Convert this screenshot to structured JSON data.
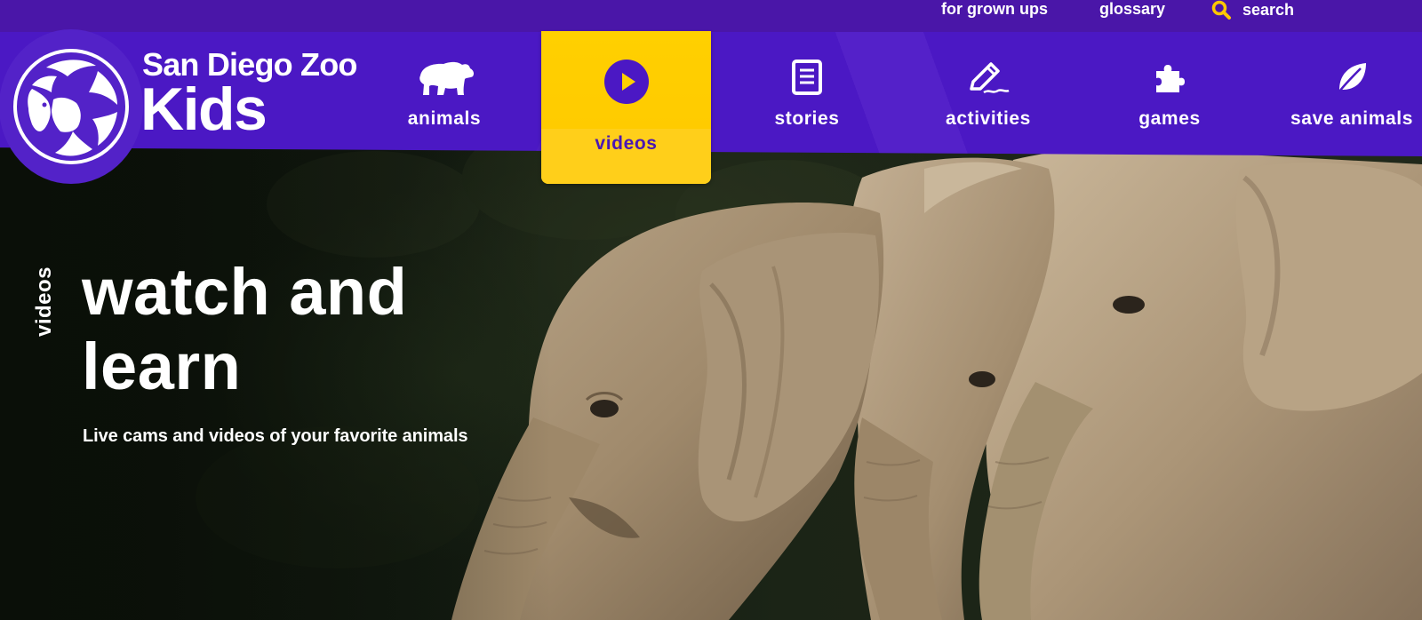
{
  "utility": {
    "grown_ups": "for grown ups",
    "glossary": "glossary",
    "search": "search"
  },
  "logo": {
    "line1": "San Diego Zoo",
    "line2": "Kids"
  },
  "nav": {
    "animals": "animals",
    "videos": "videos",
    "stories": "stories",
    "activities": "activities",
    "games": "games",
    "save_animals": "save animals"
  },
  "hero": {
    "section_label": "videos",
    "title": "watch and learn",
    "subtitle": "Live cams and videos of your favorite animals"
  },
  "icons": {
    "search": "search-icon",
    "animals": "bear-icon",
    "videos": "play-icon",
    "stories": "document-icon",
    "activities": "pencil-icon",
    "games": "puzzle-icon",
    "save_animals": "leaf-icon",
    "logo": "lion-icon"
  },
  "colors": {
    "brand_purple": "#4b18c4",
    "utility_purple": "#4a16a8",
    "active_yellow": "#ffd000",
    "search_icon": "#ffc800"
  }
}
